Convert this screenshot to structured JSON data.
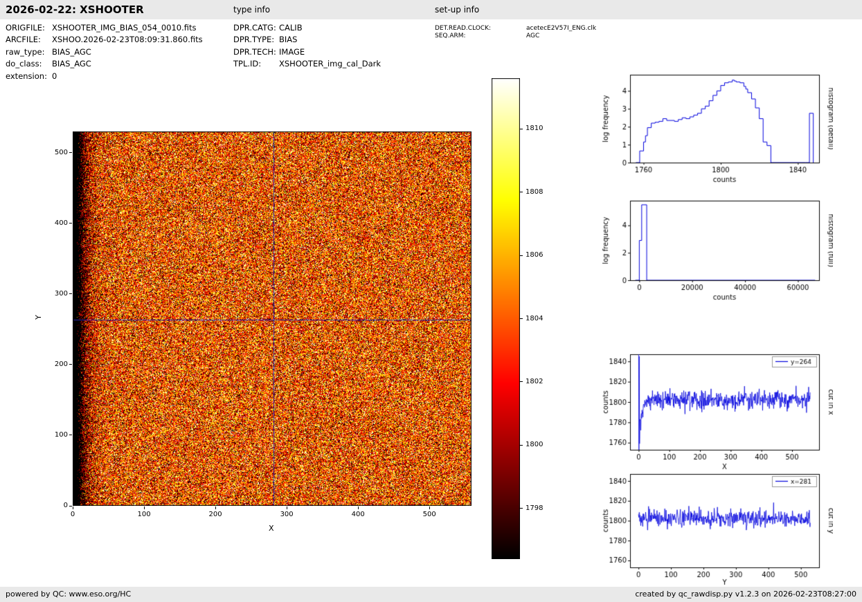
{
  "header": {
    "title": "2026-02-22: XSHOOTER",
    "type_info_label": "type info",
    "setup_info_label": "set-up info"
  },
  "meta": {
    "left": [
      {
        "label": "ORIGFILE:",
        "value": "XSHOOTER_IMG_BIAS_054_0010.fits"
      },
      {
        "label": "ARCFILE:",
        "value": "XSHOO.2026-02-23T08:09:31.860.fits"
      },
      {
        "label": "raw_type:",
        "value": "BIAS_AGC"
      },
      {
        "label": "do_class:",
        "value": "BIAS_AGC"
      },
      {
        "label": "extension:",
        "value": "0"
      }
    ],
    "middle": [
      {
        "label": "DPR.CATG:",
        "value": "CALIB"
      },
      {
        "label": "DPR.TYPE:",
        "value": "BIAS"
      },
      {
        "label": "DPR.TECH:",
        "value": "IMAGE"
      },
      {
        "label": "TPL.ID:",
        "value": "XSHOOTER_img_cal_Dark"
      }
    ],
    "right": [
      {
        "label": "DET.READ.CLOCK:",
        "value": "acetecE2V57I_ENG.clk"
      },
      {
        "label": "SEQ.ARM:",
        "value": "AGC"
      }
    ]
  },
  "footer": {
    "left": "powered by QC: www.eso.org/HC",
    "right": "created by qc_rawdisp.py v1.2.3 on 2026-02-23T08:27:00"
  },
  "colors": {
    "accent_line": "#0000dd",
    "crosshair": "#2a2aa8",
    "bar_bg": "#e9e9e9"
  },
  "chart_data": [
    {
      "id": "bias-image",
      "type": "heatmap",
      "xlabel": "X",
      "ylabel": "Y",
      "xlim": [
        0,
        559
      ],
      "ylim": [
        0,
        530
      ],
      "xticks": [
        0,
        100,
        200,
        300,
        400,
        500
      ],
      "yticks": [
        0,
        100,
        200,
        300,
        400,
        500
      ],
      "colormap": "hot",
      "clim": [
        1796.4,
        1811.6
      ],
      "mean_counts": 1803.5,
      "noise_sigma": 4.4,
      "prescan_black_cols": 5.5,
      "edge_dark_depth": 14,
      "edge_dark_decay": 11,
      "crosshair": {
        "x": 281,
        "y": 264
      },
      "colorbar_ticks": [
        1798,
        1800,
        1802,
        1804,
        1806,
        1808,
        1810
      ]
    },
    {
      "id": "histogram-detail",
      "type": "step",
      "xlabel": "counts",
      "ylabel": "log frequency",
      "side_label": "histogram (detail)",
      "xlim": [
        1753,
        1851
      ],
      "ylim": [
        0,
        4.9
      ],
      "xticks": [
        1760,
        1800,
        1840
      ],
      "yticks": [
        0,
        1,
        2,
        3,
        4
      ],
      "points": [
        [
          1756,
          0
        ],
        [
          1758,
          0.65
        ],
        [
          1760,
          1.15
        ],
        [
          1761,
          1.5
        ],
        [
          1762,
          1.95
        ],
        [
          1764,
          2.2
        ],
        [
          1766,
          2.25
        ],
        [
          1768,
          2.3
        ],
        [
          1770,
          2.45
        ],
        [
          1772,
          2.35
        ],
        [
          1776,
          2.3
        ],
        [
          1778,
          2.4
        ],
        [
          1780,
          2.5
        ],
        [
          1782,
          2.45
        ],
        [
          1784,
          2.55
        ],
        [
          1786,
          2.65
        ],
        [
          1788,
          2.75
        ],
        [
          1790,
          3.0
        ],
        [
          1792,
          3.15
        ],
        [
          1794,
          3.45
        ],
        [
          1796,
          3.75
        ],
        [
          1798,
          4.0
        ],
        [
          1800,
          4.3
        ],
        [
          1802,
          4.45
        ],
        [
          1804,
          4.5
        ],
        [
          1806,
          4.6
        ],
        [
          1807,
          4.55
        ],
        [
          1808,
          4.5
        ],
        [
          1810,
          4.45
        ],
        [
          1812,
          4.25
        ],
        [
          1813,
          4.1
        ],
        [
          1814,
          3.9
        ],
        [
          1816,
          3.55
        ],
        [
          1818,
          3.05
        ],
        [
          1820,
          2.45
        ],
        [
          1822,
          1.15
        ],
        [
          1824,
          0.95
        ],
        [
          1826,
          0
        ],
        [
          1844,
          0
        ],
        [
          1846,
          2.75
        ],
        [
          1848,
          0
        ]
      ]
    },
    {
      "id": "histogram-full",
      "type": "step",
      "xlabel": "counts",
      "ylabel": "log frequency",
      "side_label": "histogram (full)",
      "xlim": [
        -3500,
        68000
      ],
      "ylim": [
        0,
        5.8
      ],
      "xticks": [
        0,
        20000,
        40000,
        60000
      ],
      "yticks": [
        0,
        2,
        4
      ],
      "points": [
        [
          -1500,
          0
        ],
        [
          0,
          2.9
        ],
        [
          900,
          5.5
        ],
        [
          2800,
          0
        ],
        [
          66500,
          0
        ]
      ]
    },
    {
      "id": "cut-in-x",
      "type": "noise-line",
      "xlabel": "X",
      "ylabel": "counts",
      "side_label": "cut in x",
      "legend": "y=264",
      "xlim": [
        -28,
        588
      ],
      "ylim": [
        1753,
        1847
      ],
      "xticks": [
        0,
        100,
        200,
        300,
        400,
        500
      ],
      "yticks": [
        1760,
        1780,
        1800,
        1820,
        1840
      ],
      "n": 560,
      "mean": 1802.5,
      "sigma": 4.5,
      "seed": 1234,
      "start_spike": true,
      "edge_dip": {
        "depth": 30,
        "decay": 10
      }
    },
    {
      "id": "cut-in-y",
      "type": "noise-line",
      "xlabel": "Y",
      "ylabel": "counts",
      "side_label": "cut in y",
      "legend": "x=281",
      "xlim": [
        -26,
        556
      ],
      "ylim": [
        1753,
        1847
      ],
      "xticks": [
        0,
        100,
        200,
        300,
        400,
        500
      ],
      "yticks": [
        1760,
        1780,
        1800,
        1820,
        1840
      ],
      "n": 530,
      "mean": 1802.5,
      "sigma": 4.5,
      "seed": 777,
      "start_spike": false
    }
  ]
}
